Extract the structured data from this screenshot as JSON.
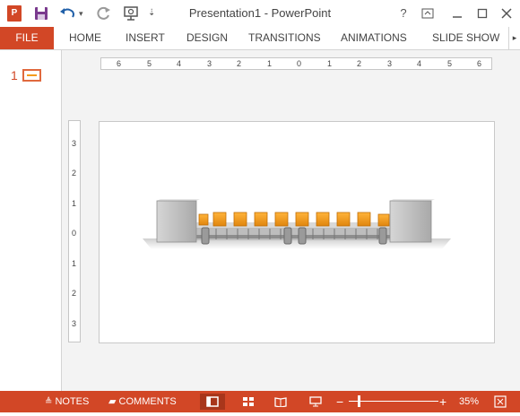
{
  "app": {
    "logo_text": "P",
    "title": "Presentation1 - PowerPoint"
  },
  "qat": {
    "save_icon": "floppy-disk-icon",
    "undo_icon": "undo-arrow-icon",
    "redo_icon": "redo-icon",
    "present_icon": "start-from-beginning-icon",
    "customize_icon": "customize-dropdown-icon"
  },
  "window_controls": {
    "help": "?",
    "ribbon_display": "ribbon-display-options-icon",
    "minimize": "minimize-icon",
    "restore": "restore-icon",
    "close": "close-icon"
  },
  "ribbon": {
    "file_label": "FILE",
    "tabs": [
      "HOME",
      "INSERT",
      "DESIGN",
      "TRANSITIONS",
      "ANIMATIONS",
      "SLIDE SHOW"
    ]
  },
  "thumbnails": {
    "number": "1"
  },
  "ruler": {
    "horizontal": [
      "6",
      "5",
      "4",
      "3",
      "2",
      "1",
      "0",
      "1",
      "2",
      "3",
      "4",
      "5",
      "6"
    ],
    "vertical": [
      "3",
      "2",
      "1",
      "0",
      "1",
      "2",
      "3"
    ]
  },
  "slide": {
    "image": "conveyor-belt-graphic",
    "colors": {
      "box": "#f49b1c",
      "block": "#c9c9c9"
    }
  },
  "status": {
    "notes_label": "NOTES",
    "comments_label": "COMMENTS",
    "zoom": "35%",
    "zoom_fraction": 0.35,
    "colors": {
      "accent": "#d24726"
    }
  }
}
